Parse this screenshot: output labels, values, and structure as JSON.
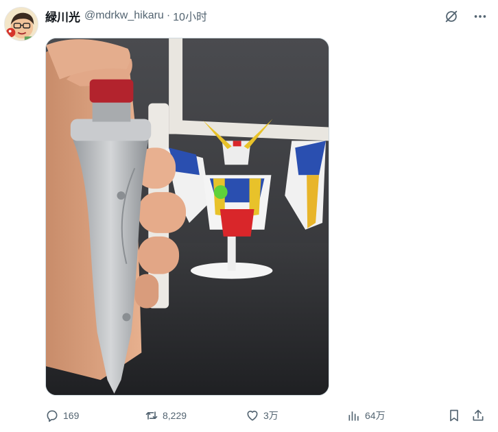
{
  "tweet": {
    "author": {
      "display_name": "緑川光",
      "handle": "@mdrkw_hikaru"
    },
    "separator": "·",
    "time": "10小时",
    "media": {
      "description_icon": "photo"
    },
    "stats": {
      "replies": "169",
      "retweets": "8,229",
      "likes": "3万",
      "views": "64万"
    }
  },
  "colors": {
    "text_primary": "#0f1419",
    "text_secondary": "#536471",
    "border": "#cfd9de"
  }
}
